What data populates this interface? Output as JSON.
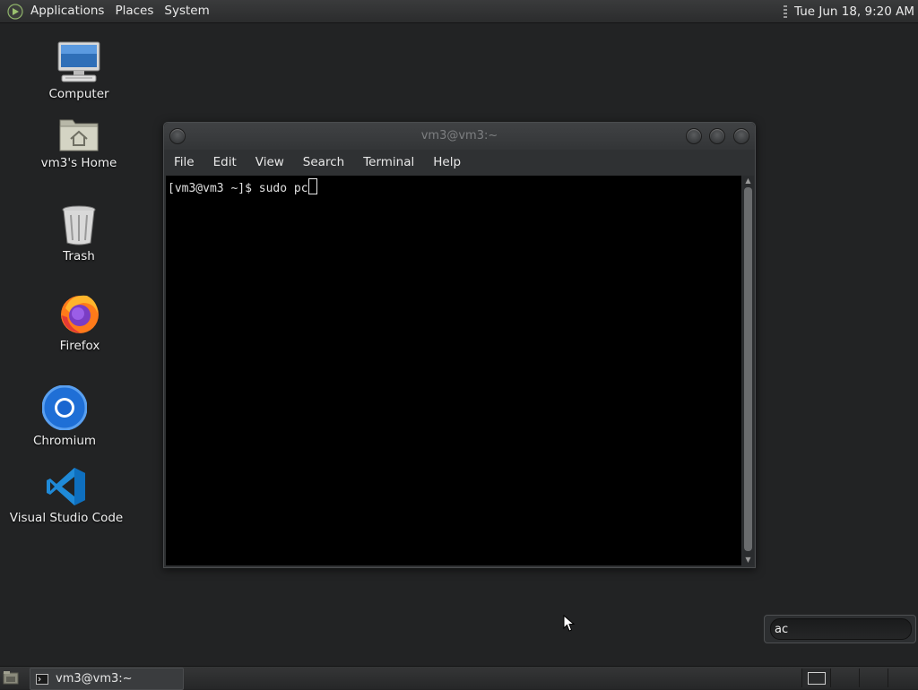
{
  "top_panel": {
    "menus": [
      "Applications",
      "Places",
      "System"
    ],
    "clock": "Tue Jun 18,  9:20 AM"
  },
  "desktop_icons": [
    {
      "label": "Computer",
      "icon": "computer-icon"
    },
    {
      "label": "vm3's Home",
      "icon": "home-folder-icon"
    },
    {
      "label": "Trash",
      "icon": "trash-icon"
    },
    {
      "label": "Firefox",
      "icon": "firefox-icon"
    },
    {
      "label": "Chromium",
      "icon": "chromium-icon"
    },
    {
      "label": "Visual Studio Code",
      "icon": "vscode-icon"
    }
  ],
  "terminal": {
    "title": "vm3@vm3:~",
    "menu": [
      "File",
      "Edit",
      "View",
      "Search",
      "Terminal",
      "Help"
    ],
    "prompt_line": "[vm3@vm3 ~]$ sudo pc"
  },
  "search": {
    "value": "ac"
  },
  "bottom_panel": {
    "task_label": "vm3@vm3:~"
  },
  "colors": {
    "desktop_bg": "#222324",
    "terminal_bg": "#000000",
    "panel_bg": "#2b2c2d"
  }
}
